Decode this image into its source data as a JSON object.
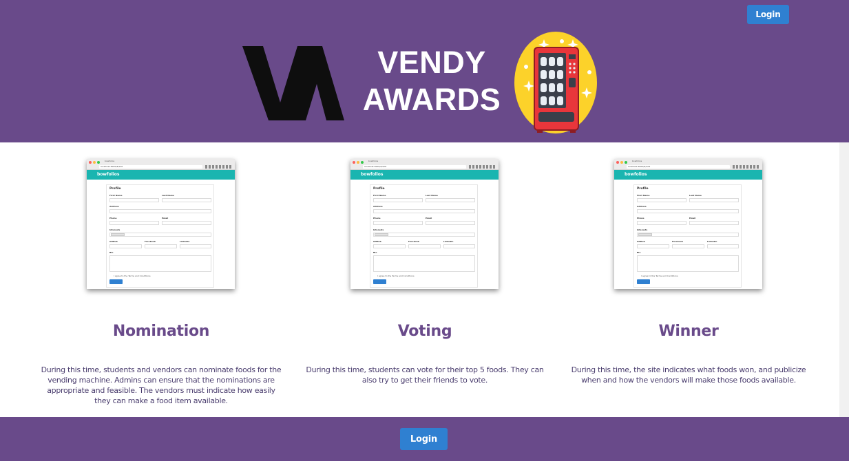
{
  "header": {
    "login_label": "Login",
    "logo_text": "VA",
    "title_line1": "VENDY",
    "title_line2": "AWARDS",
    "colors": {
      "background": "#694a8a",
      "button": "#2f80d1"
    },
    "illustration_icon": "vending-machine-icon"
  },
  "stages": [
    {
      "title": "Nomination",
      "description": "During this time, students and vendors can nominate foods for the vending machine. Admins can ensure that the nominations are appropriate and feasible. The vendors must indicate how easily they can make a food item available."
    },
    {
      "title": "Voting",
      "description": "During this time, students can vote for their top 5 foods. They can also try to get their friends to vote."
    },
    {
      "title": "Winner",
      "description": "During this time, the site indicates what foods won, and publicize when and how the vendors will make those foods available."
    }
  ],
  "preview": {
    "tab_title": "bowfolios",
    "url": "localhost:3000/#/add",
    "brand": "bowfolios",
    "heading": "Profile",
    "first_name_label": "First Name",
    "last_name_label": "Last Name",
    "address_label": "Address",
    "phone_label": "Phone",
    "email_label": "Email",
    "interests_label": "Interests",
    "interest_chip": "Algorithms",
    "github_label": "GitHub",
    "facebook_label": "Facebook",
    "linkedin_label": "Linkedin",
    "bio_label": "Bio",
    "terms_text": "I agree to the Terms and Conditions",
    "submit_label": "Submit"
  },
  "footer": {
    "login_label": "Login"
  }
}
